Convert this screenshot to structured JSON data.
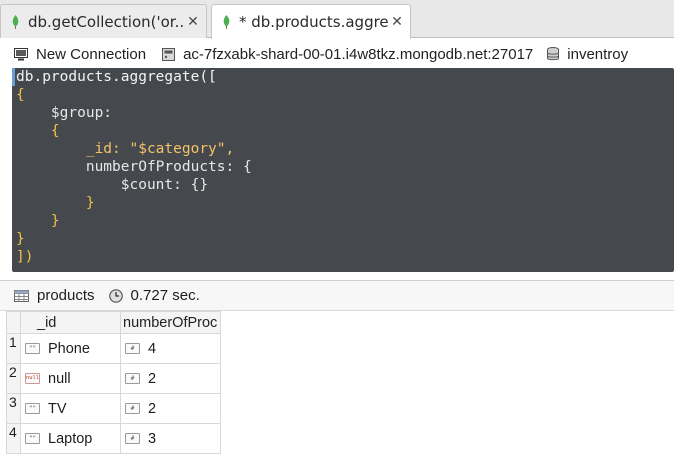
{
  "tabs": [
    {
      "label": "db.getCollection('or...",
      "close": "✕",
      "active": false
    },
    {
      "label": "* db.products.aggreg...",
      "close": "✕",
      "active": true
    }
  ],
  "connection": {
    "name": "New Connection",
    "host": "ac-7fzxabk-shard-00-01.i4w8tkz.mongodb.net:27017",
    "database": "inventroy"
  },
  "editor": {
    "lines": [
      "db.products.aggregate([",
      "{",
      "    $group:",
      "    {",
      "        _id: \"$category\",",
      "        numberOfProducts: {",
      "            $count: {}",
      "        }",
      "    }",
      "}",
      "])"
    ]
  },
  "results": {
    "collection": "products",
    "time": "0.727 sec.",
    "columns": [
      "_id",
      "numberOfProc"
    ],
    "rows": [
      {
        "num": "1",
        "type": "\"\"",
        "id": "Phone",
        "count_type": "#",
        "count": "4"
      },
      {
        "num": "2",
        "type": "null",
        "id": "null",
        "count_type": "#",
        "count": "2"
      },
      {
        "num": "3",
        "type": "\"\"",
        "id": "TV",
        "count_type": "#",
        "count": "2"
      },
      {
        "num": "4",
        "type": "\"\"",
        "id": "Laptop",
        "count_type": "#",
        "count": "3"
      }
    ]
  },
  "colors": {
    "editor_bg": "#45494d",
    "leaf_green": "#4caf50",
    "bracket": "#f0c048"
  },
  "icons": {
    "tab": "mongodb-leaf-icon",
    "connection": "computer-icon",
    "server": "server-icon",
    "database": "database-icon",
    "collection": "table-icon",
    "time": "clock-icon"
  }
}
